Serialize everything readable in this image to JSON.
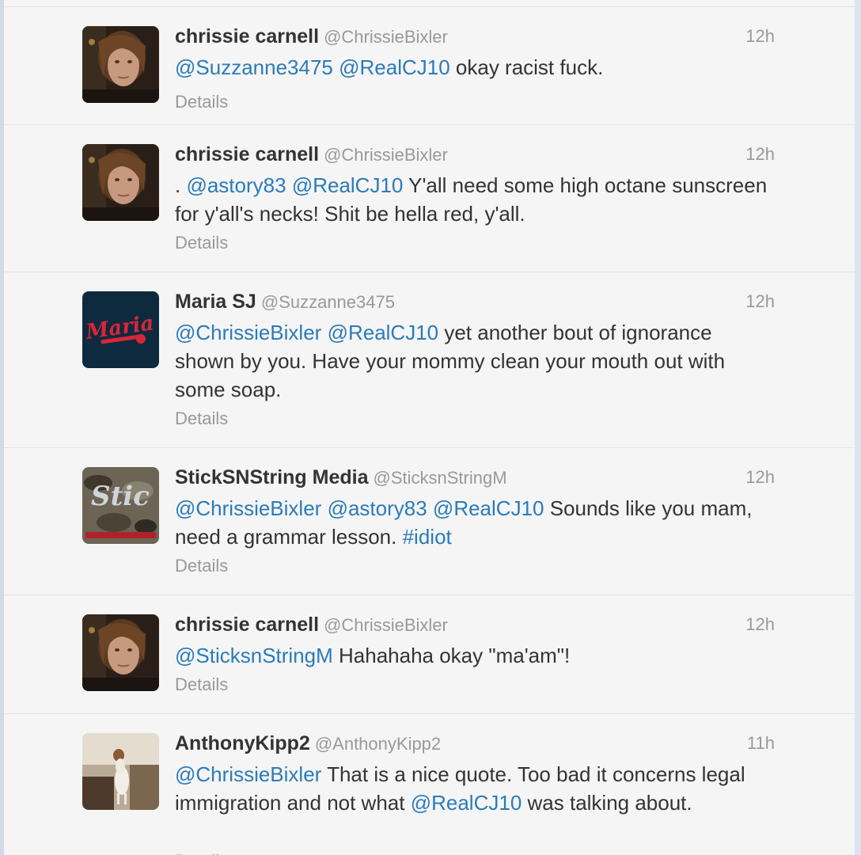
{
  "colors": {
    "link": "#2b7bb9",
    "name": "#333333",
    "meta": "#999999",
    "background": "#f5f5f5"
  },
  "tweets": [
    {
      "fullname": "chrissie carnell",
      "username": "@ChrissieBixler",
      "time": "12h",
      "avatar_icon": "woman-portrait-avatar",
      "text": [
        {
          "t": "mention",
          "v": "@Suzzanne3475"
        },
        {
          "t": "text",
          "v": " "
        },
        {
          "t": "mention",
          "v": "@RealCJ10"
        },
        {
          "t": "text",
          "v": " okay racist fuck."
        }
      ],
      "details": "Details"
    },
    {
      "fullname": "chrissie carnell",
      "username": "@ChrissieBixler",
      "time": "12h",
      "avatar_icon": "woman-portrait-avatar",
      "text": [
        {
          "t": "text",
          "v": ". "
        },
        {
          "t": "mention",
          "v": "@astory83"
        },
        {
          "t": "text",
          "v": " "
        },
        {
          "t": "mention",
          "v": "@RealCJ10"
        },
        {
          "t": "text",
          "v": " Y'all need some high octane sunscreen for y'all's necks! Shit be hella red, y'all."
        }
      ],
      "details": "Details"
    },
    {
      "fullname": "Maria SJ",
      "username": "@Suzzanne3475",
      "time": "12h",
      "avatar_icon": "maria-logo-avatar",
      "text": [
        {
          "t": "mention",
          "v": "@ChrissieBixler"
        },
        {
          "t": "text",
          "v": " "
        },
        {
          "t": "mention",
          "v": "@RealCJ10"
        },
        {
          "t": "text",
          "v": " yet another bout of ignorance shown by you.  Have your mommy clean your mouth out with some soap."
        }
      ],
      "details": "Details"
    },
    {
      "fullname": "StickSNString Media",
      "username": "@SticksnStringM",
      "time": "12h",
      "avatar_icon": "camo-logo-avatar",
      "text": [
        {
          "t": "mention",
          "v": "@ChrissieBixler"
        },
        {
          "t": "text",
          "v": " "
        },
        {
          "t": "mention",
          "v": "@astory83"
        },
        {
          "t": "text",
          "v": " "
        },
        {
          "t": "mention",
          "v": "@RealCJ10"
        },
        {
          "t": "text",
          "v": " Sounds like you mam, need a grammar lesson. "
        },
        {
          "t": "hashtag",
          "v": "#idiot"
        }
      ],
      "details": "Details"
    },
    {
      "fullname": "chrissie carnell",
      "username": "@ChrissieBixler",
      "time": "12h",
      "avatar_icon": "woman-portrait-avatar",
      "text": [
        {
          "t": "mention",
          "v": "@SticksnStringM"
        },
        {
          "t": "text",
          "v": " Hahahaha okay \"ma'am\"!"
        }
      ],
      "details": "Details"
    },
    {
      "fullname": "AnthonyKipp2",
      "username": "@AnthonyKipp2",
      "time": "11h",
      "avatar_icon": "dog-photo-avatar",
      "text": [
        {
          "t": "mention",
          "v": "@ChrissieBixler"
        },
        {
          "t": "text",
          "v": " That is a nice quote.  Too bad it concerns legal immigration and not what "
        },
        {
          "t": "mention",
          "v": "@RealCJ10"
        },
        {
          "t": "text",
          "v": " was talking about."
        }
      ],
      "details": "Details"
    }
  ]
}
